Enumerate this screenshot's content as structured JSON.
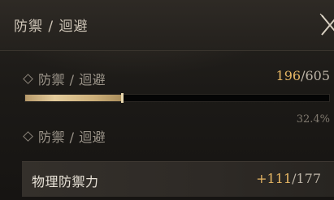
{
  "header": {
    "title": "防禦 / 迴避",
    "close_icon": "close-x-icon"
  },
  "section_1": {
    "label": "防禦 / 迴避",
    "icon": "diamond-icon",
    "current": "196",
    "separator": "/",
    "max": "605",
    "progress_fraction": 0.324,
    "percent_text": "32.4%"
  },
  "section_2": {
    "label": "防禦 / 迴避",
    "icon": "diamond-icon"
  },
  "stat": {
    "name": "物理防禦力",
    "bonus": "+111",
    "separator": "/",
    "max": "177"
  },
  "colors": {
    "accent_gold": "#e6b664",
    "text_muted": "#9c958a",
    "progress_fill": "#d9bf8c"
  }
}
